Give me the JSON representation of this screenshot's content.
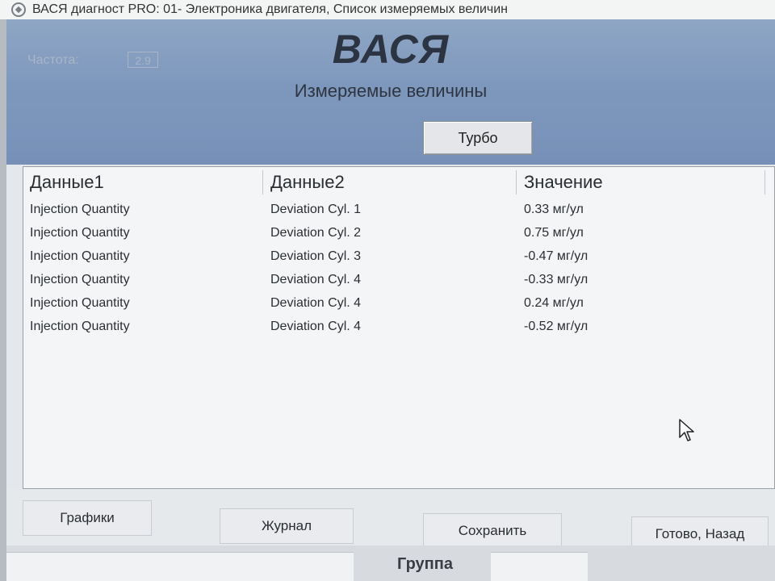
{
  "window": {
    "title": "ВАСЯ диагност PRO: 01- Электроника двигателя,  Список измеряемых величин"
  },
  "header": {
    "frequency_label": "Частота:",
    "frequency_value": "2.9",
    "logo": "ВАСЯ",
    "subtitle": "Измеряемые величины",
    "group_button": "Турбо"
  },
  "table": {
    "columns": [
      "Данные1",
      "Данные2",
      "Значение"
    ],
    "rows": [
      {
        "data1": "Injection Quantity",
        "data2": "Deviation Cyl. 1",
        "value": "0.33 мг/ул"
      },
      {
        "data1": "Injection Quantity",
        "data2": "Deviation Cyl. 2",
        "value": "0.75 мг/ул"
      },
      {
        "data1": "Injection Quantity",
        "data2": "Deviation Cyl. 3",
        "value": "-0.47 мг/ул"
      },
      {
        "data1": "Injection Quantity",
        "data2": "Deviation Cyl. 4",
        "value": "-0.33 мг/ул"
      },
      {
        "data1": "Injection Quantity",
        "data2": "Deviation Cyl. 4",
        "value": "0.24 мг/ул"
      },
      {
        "data1": "Injection Quantity",
        "data2": "Deviation Cyl. 4",
        "value": "-0.52 мг/ул"
      }
    ]
  },
  "footer": {
    "graphs_button": "Графики",
    "log_button": "Журнал",
    "save_button": "Сохранить",
    "done_button": "Готово, Назад"
  },
  "background": {
    "group_label": "Группа"
  },
  "colors": {
    "header_blue": "#7e98bd",
    "table_bg": "#f4f5f6"
  }
}
